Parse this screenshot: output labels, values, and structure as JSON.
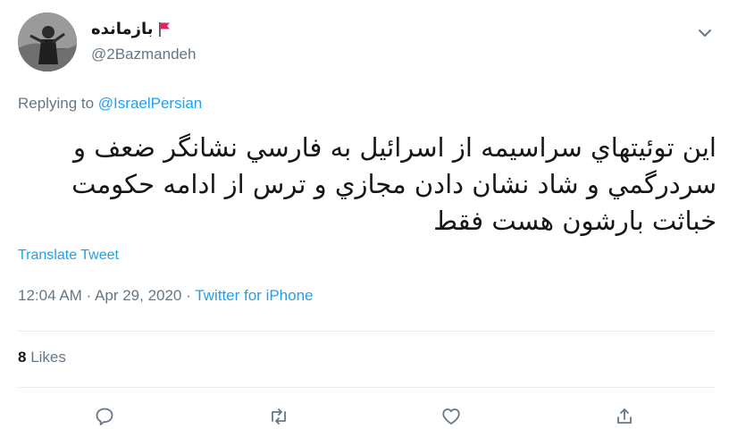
{
  "author": {
    "display_name": "بازمانده",
    "handle": "@2Bazmandeh"
  },
  "reply": {
    "prefix": "Replying to",
    "target": "@IsraelPersian"
  },
  "tweet": {
    "text": "اين توئيتهاي سراسيمه از اسرائيل به فارسي نشانگر ضعف و سردرگمي و شاد نشان دادن مجازي و ترس از ادامه حكومت خباثت بارشون هست فقط",
    "translate_label": "Translate Tweet"
  },
  "meta": {
    "time": "12:04 AM",
    "separator": "·",
    "date": "Apr 29, 2020",
    "source": "Twitter for iPhone"
  },
  "stats": {
    "likes_count": "8",
    "likes_label": "Likes"
  },
  "icons": {
    "menu": "chevron-down-icon",
    "flag": "red-flag-icon",
    "reply": "reply-icon",
    "retweet": "retweet-icon",
    "like": "heart-icon",
    "share": "share-icon"
  },
  "colors": {
    "link": "#1da1f2",
    "secondary": "#657786",
    "text": "#14171a",
    "flag": "#e0245e"
  }
}
